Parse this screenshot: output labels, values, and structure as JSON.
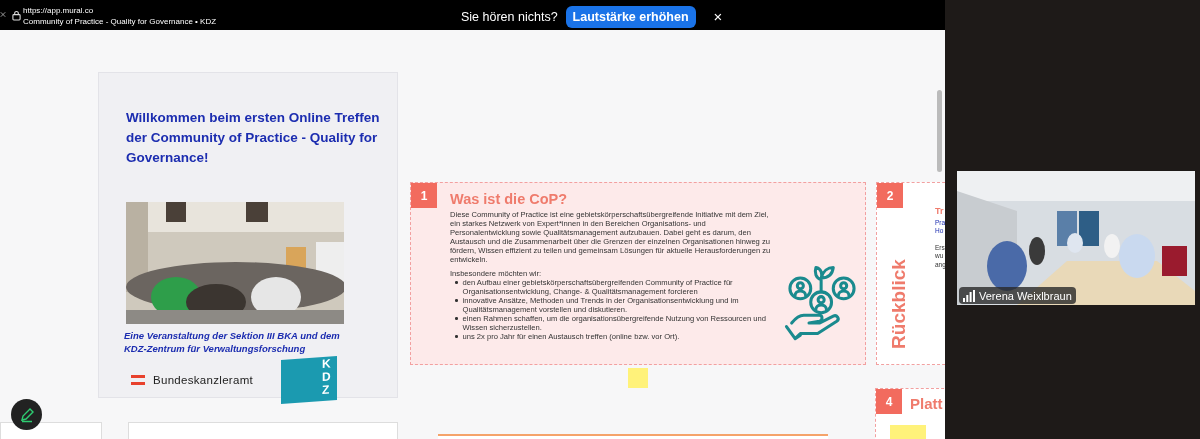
{
  "browser": {
    "url": "https://app.mural.co",
    "page_title": "Community of Practice - Quality for Governance • KDZ"
  },
  "notification": {
    "message": "Sie hören nichts?",
    "button": "Lautstärke erhöhen",
    "close": "×"
  },
  "welcome_card": {
    "title": "Willkommen beim ersten Online Treffen der Community of Practice - Quality for Governance!",
    "subtitle": "Eine Veranstaltung der Sektion III BKA und dem KDZ-Zentrum für Verwaltungsforschung",
    "ministry": "Bundeskanzleramt",
    "kdz_letters": "KDZ"
  },
  "sections": [
    {
      "kind": "text",
      "number": "1",
      "title": "Was ist die CoP?",
      "paragraph": "Diese Community of Practice ist eine gebietskörperschaftsübergreifende Initiative mit dem Ziel, ein starkes Netzwerk von Expert*innen in den Bereichen Organisations- und Personalentwicklung sowie Qualitätsmanagement aufzubauen. Dabei geht es darum, den Austausch und die Zusammenarbeit über die Grenzen der einzelnen Organisationen hinweg zu fördern, Wissen effizient zu teilen und gemeinsam Lösungen für aktuelle Herausforderungen zu entwickeln.",
      "intro": "Insbesondere möchten wir:",
      "bullets": [
        "den Aufbau einer gebietskörperschaftsübergreifenden Community of Practice für Organisationsentwicklung, Change- & Qualitätsmanagement forcieren",
        "innovative Ansätze, Methoden und Trends in der Organisationsentwicklung und im Qualitätsmanagement vorstellen und diskutieren.",
        "einen Rahmen schaffen, um die organisationsübergreifende Nutzung von Ressourcen und Wissen sicherzustellen.",
        "uns 2x pro Jahr für einen Austausch treffen (online bzw. vor Ort)."
      ]
    },
    {
      "kind": "side",
      "number": "2",
      "side_label": "Rückblick",
      "heading": "Tr",
      "blocks": [
        [
          "Pra",
          "Ho"
        ],
        [
          "Ers",
          "wu",
          "ang"
        ]
      ]
    },
    {
      "kind": "title",
      "number": "4",
      "title": "Platt"
    }
  ],
  "video": {
    "name": "Verena Weixlbraun"
  }
}
